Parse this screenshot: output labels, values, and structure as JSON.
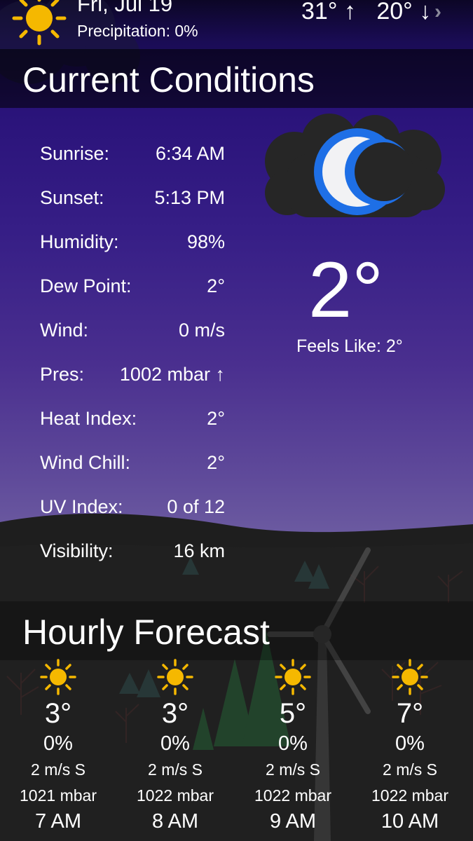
{
  "header": {
    "date": "Fri, Jul 19",
    "precipitation": "Precipitation: 0%",
    "high": "31°",
    "high_arrow": "↑",
    "low": "20°",
    "low_arrow": "↓",
    "next_icon": "chevron-right-icon",
    "weather_icon": "sun-icon"
  },
  "current": {
    "title": "Current Conditions",
    "condition_icon": "moon-icon",
    "temperature": "2°",
    "feels_like": "Feels Like: 2°",
    "rows": [
      {
        "label": "Sunrise:",
        "value": "6:34 AM"
      },
      {
        "label": "Sunset:",
        "value": "5:13 PM"
      },
      {
        "label": "Humidity:",
        "value": "98%"
      },
      {
        "label": "Dew Point:",
        "value": "2°"
      },
      {
        "label": "Wind:",
        "value": "0 m/s"
      },
      {
        "label": "Pres:",
        "value": "1002 mbar ↑"
      },
      {
        "label": "Heat Index:",
        "value": "2°"
      },
      {
        "label": "Wind Chill:",
        "value": "2°"
      },
      {
        "label": "UV Index:",
        "value": "0 of 12"
      },
      {
        "label": "Visibility:",
        "value": "16 km"
      }
    ]
  },
  "hourly": {
    "title": "Hourly Forecast",
    "hours": [
      {
        "icon": "sun-icon",
        "temp": "3°",
        "pop": "0%",
        "wind": "2 m/s S",
        "pressure": "1021 mbar",
        "time": "7 AM"
      },
      {
        "icon": "sun-icon",
        "temp": "3°",
        "pop": "0%",
        "wind": "2 m/s S",
        "pressure": "1022 mbar",
        "time": "8 AM"
      },
      {
        "icon": "sun-icon",
        "temp": "5°",
        "pop": "0%",
        "wind": "2 m/s S",
        "pressure": "1022 mbar",
        "time": "9 AM"
      },
      {
        "icon": "sun-icon",
        "temp": "7°",
        "pop": "0%",
        "wind": "2 m/s S",
        "pressure": "1022 mbar",
        "time": "10 AM"
      }
    ]
  },
  "colors": {
    "sun": "#f5b800",
    "moon_ring": "#1e6fe6",
    "moon_face": "#f2f2f4",
    "cloud": "#2a2a2a",
    "sky_top": "#0c0626",
    "sky_bottom": "#6b5aa0",
    "ground": "#222222"
  }
}
